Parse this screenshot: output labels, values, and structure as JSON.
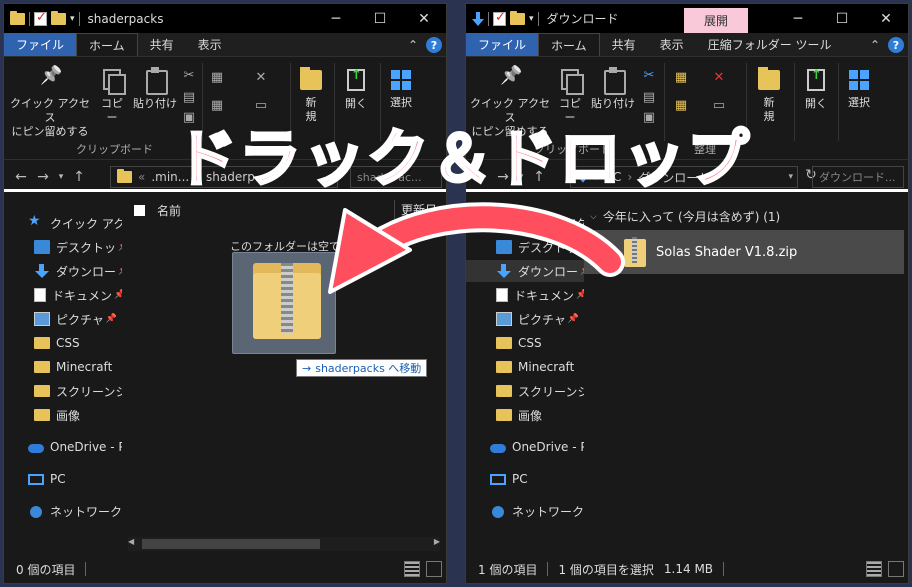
{
  "left": {
    "title": "shaderpacks",
    "tabs": [
      "ファイル",
      "ホーム",
      "共有",
      "表示"
    ],
    "ribbon": {
      "pin": "クイック アクセス\nにピン留めする",
      "copy": "コピー",
      "paste": "貼り付け",
      "group_clipboard": "クリップボード",
      "new": "新\n規",
      "open": "開く",
      "select": "選択"
    },
    "address": ".min...",
    "address2": "shaderp...",
    "search": "shader",
    "search2": "ac...",
    "col_name": "名前",
    "col_date": "更新日時",
    "empty": "このフォルダーは空です。",
    "status": "0 個の項目",
    "sidebar": [
      "クイック アクセス",
      "デスクトッ",
      "ダウンロー",
      "ドキュメン",
      "ピクチャ",
      "CSS",
      "Minecraft",
      "スクリーンショ",
      "画像",
      "OneDrive - Pe",
      "PC",
      "ネットワーク"
    ],
    "drag_tip_arrow": "→",
    "drag_tip": "shaderpacks へ移動"
  },
  "right": {
    "title": "ダウンロード",
    "ctx_tab": "展開",
    "tabs": [
      "ファイル",
      "ホーム",
      "共有",
      "表示",
      "圧縮フォルダー ツール"
    ],
    "ribbon": {
      "pin": "クイック アクセス\nにピン留めする",
      "copy": "コピー",
      "paste": "貼り付け",
      "group_clipboard": "クリップボード",
      "group_organize": "整理",
      "new": "新\n規",
      "open": "開く",
      "select": "選択"
    },
    "address_pc": "PC",
    "address_dl": "ダウンロード",
    "search": "ダウンロード...",
    "group_header": "今年に入って (今月は含めず) (1)",
    "file_name": "Solas Shader V1.8.zip",
    "status_items": "1 個の項目",
    "status_selected": "1 個の項目を選択",
    "status_size": "1.14 MB",
    "sidebar": [
      "クイック アクセス",
      "デスクトッ",
      "ダウンロー",
      "ドキュメン",
      "ピクチャ",
      "CSS",
      "Minecraft",
      "スクリーンショ",
      "画像",
      "OneDrive - Pe",
      "PC",
      "ネットワーク"
    ]
  },
  "overlay": {
    "headline": "ドラック＆ドロップ",
    "arrow_color": "#ff4f5e"
  },
  "colors": {
    "accent": "#2f63b0",
    "folder": "#e8c35a",
    "ribbon_ctx": "#f9c9d9"
  }
}
